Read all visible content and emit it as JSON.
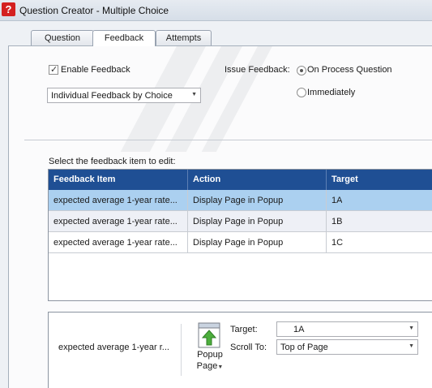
{
  "window": {
    "title": "Question Creator - Multiple Choice"
  },
  "tabs": [
    {
      "label": "Question",
      "active": false
    },
    {
      "label": "Feedback",
      "active": true
    },
    {
      "label": "Attempts",
      "active": false
    }
  ],
  "feedback": {
    "enable_label": "Enable Feedback",
    "enabled": true,
    "type_value": "Individual Feedback by Choice",
    "issue_label": "Issue Feedback:",
    "issue_options": [
      {
        "label": "On Process Question",
        "selected": true
      },
      {
        "label": "Immediately",
        "selected": false
      }
    ]
  },
  "grid": {
    "prompt": "Select the feedback item to edit:",
    "columns": [
      "Feedback Item",
      "Action",
      "Target"
    ],
    "rows": [
      {
        "item": "expected average 1-year rate...",
        "action": "Display Page in Popup",
        "target": "1A",
        "selected": true
      },
      {
        "item": "expected average 1-year rate...",
        "action": "Display Page in Popup",
        "target": "1B",
        "selected": false
      },
      {
        "item": "expected average 1-year rate...",
        "action": "Display Page in Popup",
        "target": "1C",
        "selected": false
      }
    ]
  },
  "detail": {
    "item_text": "expected average 1-year r...",
    "popup_label_line1": "Popup",
    "popup_label_line2": "Page",
    "target_label": "Target:",
    "target_value": "1A",
    "scroll_label": "Scroll To:",
    "scroll_value": "Top of Page"
  },
  "icons": {
    "app": "question-mark-icon",
    "popup": "popup-page-icon",
    "dropdown": "chevron-down-icon"
  },
  "colors": {
    "grid_header": "#1f4f94",
    "selected_row": "#abd0f0",
    "app_icon": "#d42020"
  }
}
